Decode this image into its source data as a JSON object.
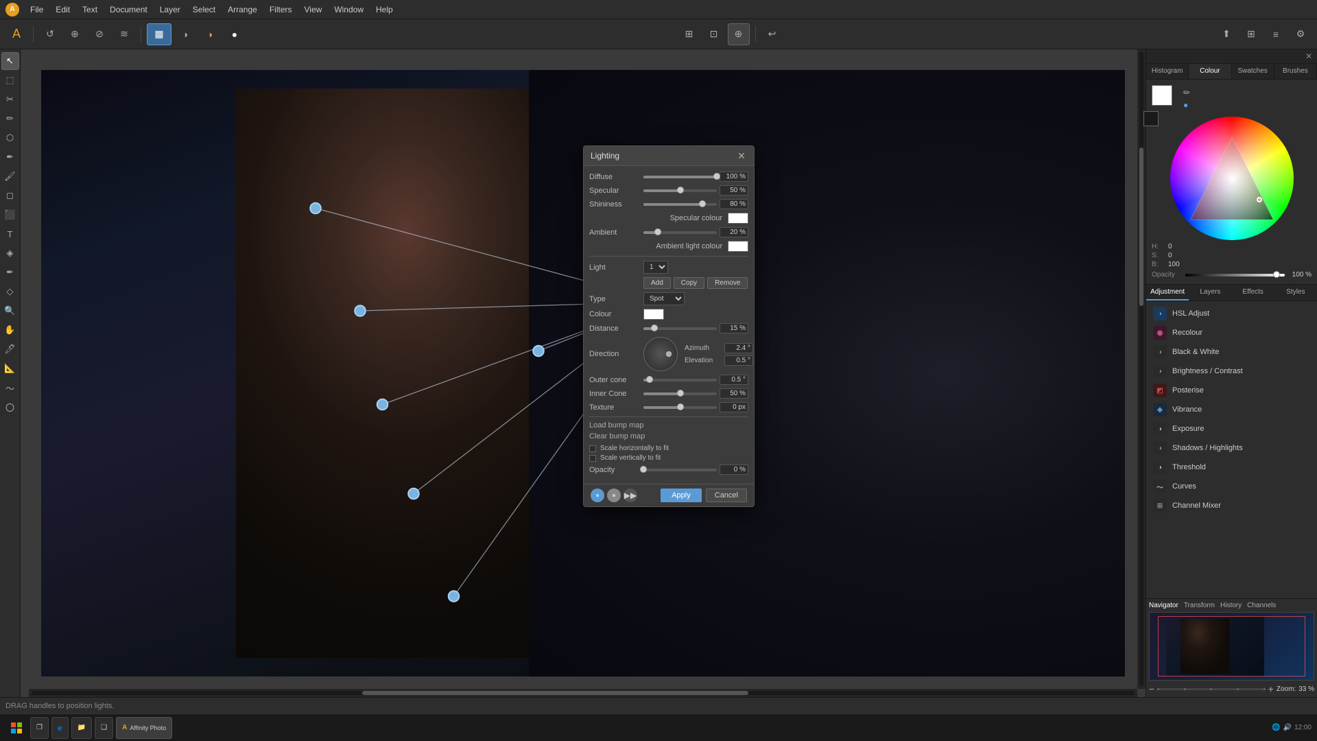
{
  "app": {
    "title": "Affinity Photo",
    "logo": "A"
  },
  "menu": {
    "items": [
      "File",
      "Edit",
      "Text",
      "Document",
      "Layer",
      "Select",
      "Arrange",
      "Filters",
      "View",
      "Window",
      "Help"
    ]
  },
  "toolbar": {
    "tools": [
      "↩",
      "↺",
      "⊕",
      "⊘"
    ]
  },
  "left_tools": {
    "tools": [
      "↖",
      "◻",
      "✏",
      "✂",
      "⬡",
      "✒",
      "🖌",
      "⬚",
      "T",
      "◈",
      "🔍"
    ]
  },
  "dialog": {
    "title": "Lighting",
    "diffuse_label": "Diffuse",
    "diffuse_value": "100 %",
    "diffuse_pct": 100,
    "specular_label": "Specular",
    "specular_value": "50 %",
    "specular_pct": 50,
    "shininess_label": "Shininess",
    "shininess_value": "80 %",
    "shininess_pct": 80,
    "specular_colour_label": "Specular colour",
    "ambient_label": "Ambient",
    "ambient_value": "20 %",
    "ambient_pct": 20,
    "ambient_light_colour_label": "Ambient light colour",
    "light_label": "Light",
    "light_value": "1",
    "add_btn": "Add",
    "copy_btn": "Copy",
    "remove_btn": "Remove",
    "type_label": "Type",
    "type_value": "Spot",
    "colour_label": "Colour",
    "distance_label": "Distance",
    "distance_value": "15 %",
    "distance_pct": 15,
    "direction_label": "Direction",
    "azimuth_label": "Azimuth",
    "azimuth_value": "2.4 °",
    "elevation_label": "Elevation",
    "elevation_value": "0.5 °",
    "outer_cone_label": "Outer cone",
    "outer_cone_value": "0.5 °",
    "outer_cone_pct": 8,
    "inner_cone_label": "Inner Cone",
    "inner_cone_value": "50 %",
    "inner_cone_pct": 50,
    "texture_label": "Texture",
    "texture_value": "0 px",
    "texture_pct": 50,
    "load_bump_map": "Load bump map",
    "clear_bump_map": "Clear bump map",
    "scale_h": "Scale horizontally to fit",
    "scale_v": "Scale vertically to fit",
    "opacity_label": "Opacity",
    "opacity_value": "0 %",
    "opacity_pct": 0,
    "apply_btn": "Apply",
    "cancel_btn": "Cancel"
  },
  "right_panel": {
    "tabs": [
      "Histogram",
      "Colour",
      "Swatches",
      "Brushes"
    ],
    "active_tab": "Colour",
    "hsb": {
      "h_label": "H:",
      "h_value": "0",
      "s_label": "S:",
      "s_value": "0",
      "b_label": "B:",
      "b_value": "100",
      "opacity_label": "Opacity",
      "opacity_value": "100 %"
    },
    "adj_tabs": [
      "Adjustment",
      "Layers",
      "Effects",
      "Styles"
    ],
    "active_adj_tab": "Adjustment",
    "adjustments": [
      {
        "id": "hsl-adjust",
        "label": "HSL Adjust",
        "icon_color": "#5b9bd5",
        "icon_char": "◑"
      },
      {
        "id": "recolour",
        "label": "Recolour",
        "icon_color": "#c45c8c",
        "icon_char": "◉"
      },
      {
        "id": "black-white",
        "label": "Black & White",
        "icon_color": "#888",
        "icon_char": "◑"
      },
      {
        "id": "brightness-contrast",
        "label": "Brightness / Contrast",
        "icon_color": "#888",
        "icon_char": "◑"
      },
      {
        "id": "posterise",
        "label": "Posterise",
        "icon_color": "#c44",
        "icon_char": "◩"
      },
      {
        "id": "vibrance",
        "label": "Vibrance",
        "icon_color": "#5b9bd5",
        "icon_char": "◈"
      },
      {
        "id": "exposure",
        "label": "Exposure",
        "icon_color": "#aaa",
        "icon_char": "◑"
      },
      {
        "id": "shadows-highlights",
        "label": "Shadows / Highlights",
        "icon_color": "#888",
        "icon_char": "◑"
      },
      {
        "id": "threshold",
        "label": "Threshold",
        "icon_color": "#aaa",
        "icon_char": "◑"
      },
      {
        "id": "curves",
        "label": "Curves",
        "icon_color": "#aaa",
        "icon_char": "~"
      },
      {
        "id": "channel-mixer",
        "label": "Channel Mixer",
        "icon_color": "#888",
        "icon_char": "⊞"
      }
    ],
    "nav_tabs": [
      "Navigator",
      "Transform",
      "History",
      "Channels"
    ],
    "active_nav_tab": "Navigator",
    "zoom_label": "Zoom:",
    "zoom_value": "33 %"
  },
  "status_bar": {
    "text": "DRAG handles to position lights."
  },
  "taskbar": {
    "items": [
      {
        "id": "start",
        "icon": "⊞"
      },
      {
        "id": "task-view",
        "icon": "❐"
      },
      {
        "id": "edge",
        "icon": "e"
      },
      {
        "id": "explorer",
        "icon": "📁"
      },
      {
        "id": "app1",
        "icon": "❑"
      },
      {
        "id": "affinity",
        "icon": "A",
        "active": true
      }
    ]
  }
}
